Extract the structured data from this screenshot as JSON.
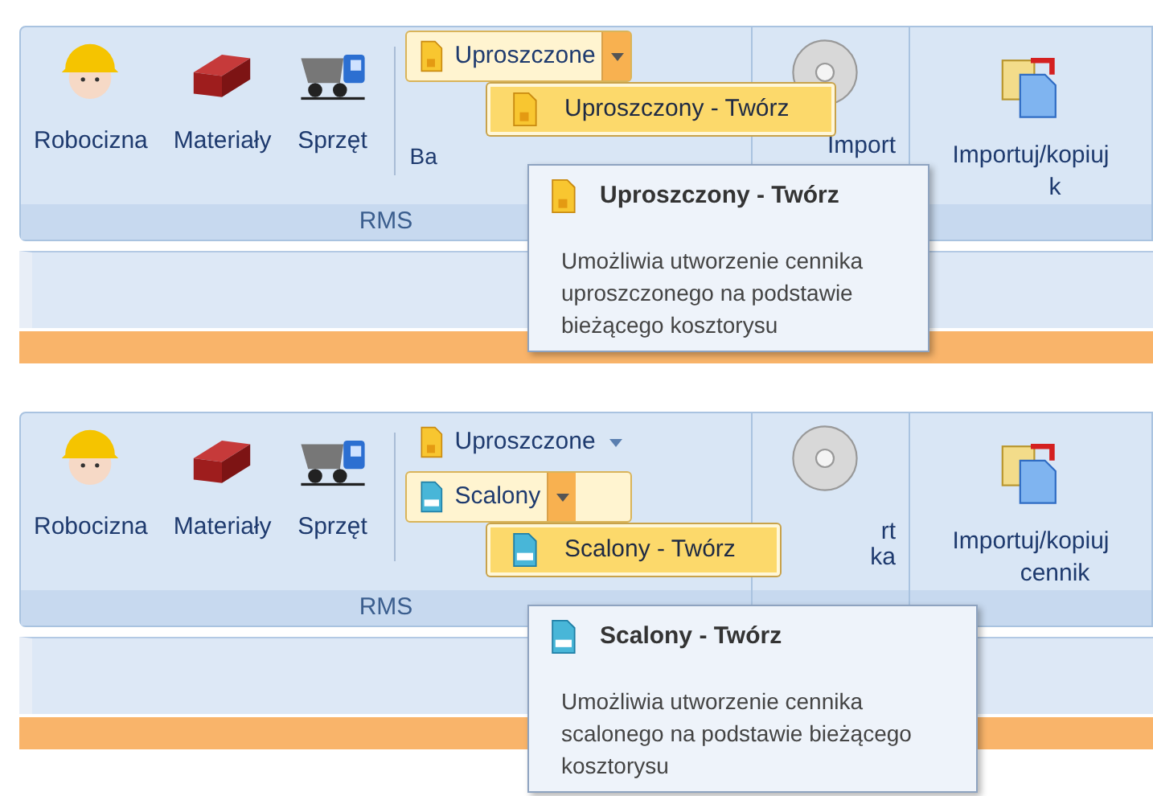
{
  "panels": [
    {
      "buttons": [
        {
          "label": "Robocizna"
        },
        {
          "label": "Materiały"
        },
        {
          "label": "Sprzęt"
        }
      ],
      "split_buttons": [
        {
          "label": "Uproszczone",
          "kind": "simplified",
          "open": true
        }
      ],
      "column_label": "Ba",
      "import_label": [
        "Import"
      ],
      "importuj_label": [
        "Importuj/kopiuj",
        "k"
      ],
      "group_label": "RMS",
      "menu": {
        "label": "Uproszczony - Twórz"
      },
      "tooltip": {
        "title": "Uproszczony - Twórz",
        "lines": [
          "Umożliwia utworzenie cennika",
          "uproszczonego na podstawie",
          "bieżącego kosztorysu"
        ]
      }
    },
    {
      "buttons": [
        {
          "label": "Robocizna"
        },
        {
          "label": "Materiały"
        },
        {
          "label": "Sprzęt"
        }
      ],
      "split_buttons": [
        {
          "label": "Uproszczone",
          "kind": "simplified",
          "open": false
        },
        {
          "label": "Scalony",
          "kind": "merged",
          "open": true
        }
      ],
      "import_label": [
        "rt",
        "ka"
      ],
      "importuj_label": [
        "Importuj/kopiuj",
        "cennik"
      ],
      "group_label": "RMS",
      "menu": {
        "label": "Scalony - Twórz"
      },
      "tooltip": {
        "title": "Scalony - Twórz",
        "lines": [
          "Umożliwia utworzenie cennika",
          "scalonego na podstawie bieżącego",
          "kosztorysu"
        ]
      }
    }
  ]
}
